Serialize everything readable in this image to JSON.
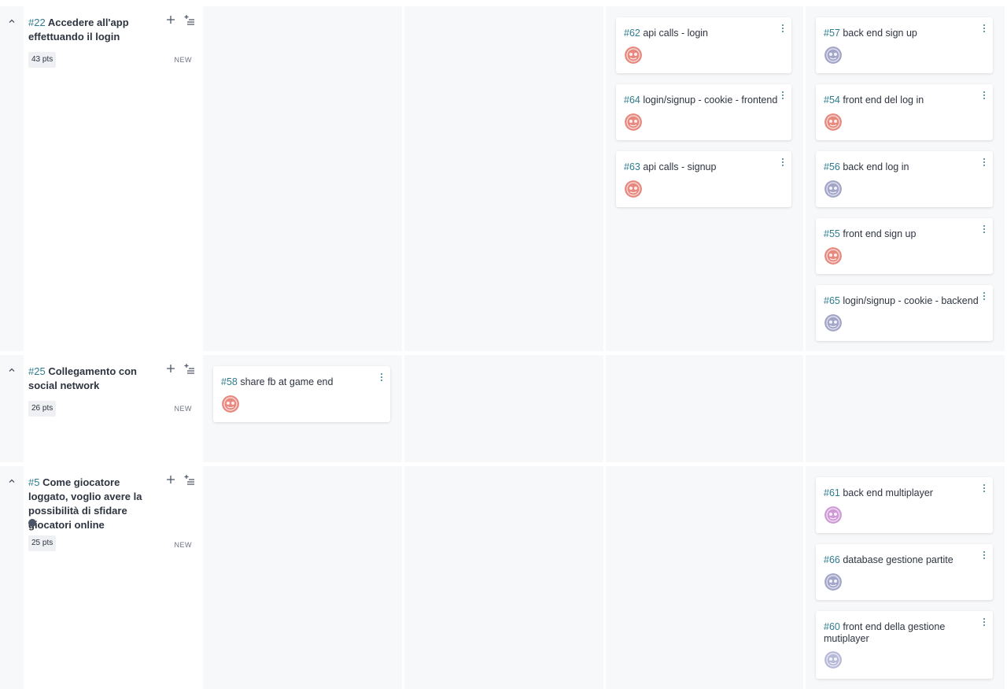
{
  "swimlanes": [
    {
      "ref": "#22",
      "title": "Accedere all'app effettuando il login",
      "points": "43 pts",
      "status": "NEW",
      "tag_color": null,
      "columns": [
        [],
        [],
        [
          {
            "ref": "#62",
            "title": "api calls - login",
            "avatar_color": "#e8897f"
          },
          {
            "ref": "#64",
            "title": "login/signup - cookie - frontend",
            "avatar_color": "#e8897f"
          },
          {
            "ref": "#63",
            "title": "api calls - signup",
            "avatar_color": "#e8897f"
          }
        ],
        [
          {
            "ref": "#57",
            "title": "back end sign up",
            "avatar_color": "#a3a5c9"
          },
          {
            "ref": "#54",
            "title": "front end del log in",
            "avatar_color": "#e8897f"
          },
          {
            "ref": "#56",
            "title": "back end log in",
            "avatar_color": "#a3a5c9"
          },
          {
            "ref": "#55",
            "title": "front end sign up",
            "avatar_color": "#e8897f"
          },
          {
            "ref": "#65",
            "title": "login/signup - cookie - backend",
            "avatar_color": "#a3a5c9"
          }
        ]
      ]
    },
    {
      "ref": "#25",
      "title": "Collegamento con social network",
      "points": "26 pts",
      "status": "NEW",
      "tag_color": null,
      "columns": [
        [
          {
            "ref": "#58",
            "title": "share fb at game end",
            "avatar_color": "#e8897f"
          }
        ],
        [],
        [],
        []
      ]
    },
    {
      "ref": "#5",
      "title": "Come giocatore loggato, voglio avere la possibilità di sfidare giocatori online",
      "points": "25 pts",
      "status": "NEW",
      "tag_color": "#4c5566",
      "columns": [
        [],
        [],
        [],
        [
          {
            "ref": "#61",
            "title": "back end multiplayer",
            "avatar_color": "#d09ad6"
          },
          {
            "ref": "#66",
            "title": "database gestione partite",
            "avatar_color": "#a3a5c9"
          },
          {
            "ref": "#60",
            "title": "front end della gestione mutiplayer",
            "avatar_color": "#b7b9d8"
          }
        ]
      ]
    }
  ],
  "icons": {
    "collapse": "chevron-up-icon",
    "add_task": "plus-icon",
    "bulk_add": "bulk-add-icon",
    "card_menu": "kebab-menu-icon",
    "avatar": "user-avatar-icon"
  }
}
